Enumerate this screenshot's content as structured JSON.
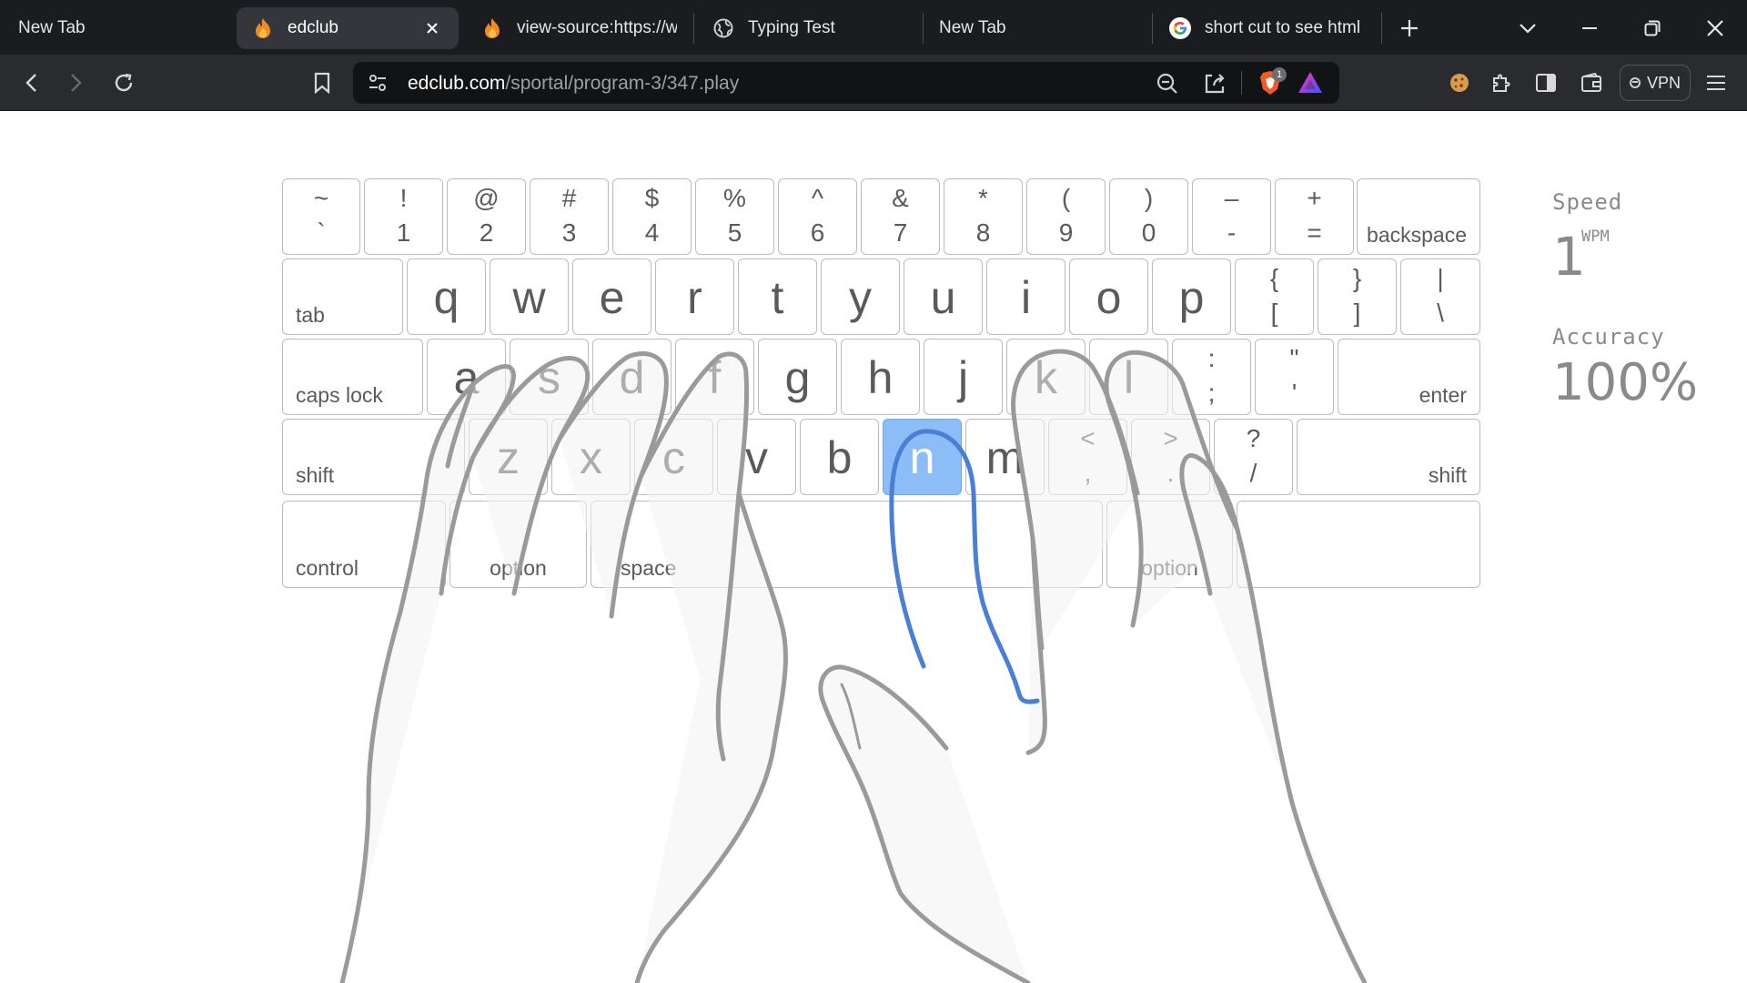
{
  "browser": {
    "tabs": [
      {
        "title": "New Tab",
        "favicon": "none",
        "active": false
      },
      {
        "title": "edclub",
        "favicon": "edclub-flame-icon",
        "active": true
      },
      {
        "title": "view-source:https://ww",
        "favicon": "edclub-flame-icon",
        "active": false
      },
      {
        "title": "Typing Test",
        "favicon": "globe-icon",
        "active": false
      },
      {
        "title": "New Tab",
        "favicon": "none",
        "active": false
      },
      {
        "title": "short cut to see html co",
        "favicon": "google-icon",
        "active": false
      }
    ],
    "url_host": "edclub.com",
    "url_path": "/sportal/program-3/347.play",
    "shields_badge": "1",
    "vpn_label": "VPN"
  },
  "keyboard": {
    "highlight_key": "n",
    "row_numbers": [
      {
        "top": "~",
        "bottom": "`"
      },
      {
        "top": "!",
        "bottom": "1"
      },
      {
        "top": "@",
        "bottom": "2"
      },
      {
        "top": "#",
        "bottom": "3"
      },
      {
        "top": "$",
        "bottom": "4"
      },
      {
        "top": "%",
        "bottom": "5"
      },
      {
        "top": "^",
        "bottom": "6"
      },
      {
        "top": "&",
        "bottom": "7"
      },
      {
        "top": "*",
        "bottom": "8"
      },
      {
        "top": "(",
        "bottom": "9"
      },
      {
        "top": ")",
        "bottom": "0"
      },
      {
        "top": "–",
        "bottom": "-"
      },
      {
        "top": "+",
        "bottom": "="
      }
    ],
    "backspace": "backspace",
    "tab": "tab",
    "row_top": [
      "q",
      "w",
      "e",
      "r",
      "t",
      "y",
      "u",
      "i",
      "o",
      "p"
    ],
    "row_top_symbols": [
      {
        "top": "{",
        "bottom": "["
      },
      {
        "top": "}",
        "bottom": "]"
      },
      {
        "top": "|",
        "bottom": "\\"
      }
    ],
    "caps_lock": "caps lock",
    "row_home": [
      "a",
      "s",
      "d",
      "f",
      "g",
      "h",
      "j",
      "k",
      "l"
    ],
    "row_home_symbols": [
      {
        "top": ":",
        "bottom": ";"
      },
      {
        "top": "\"",
        "bottom": "'"
      }
    ],
    "enter": "enter",
    "shift": "shift",
    "row_bottom": [
      "z",
      "x",
      "c",
      "v",
      "b",
      "n",
      "m"
    ],
    "row_bottom_symbols": [
      {
        "top": "<",
        "bottom": ","
      },
      {
        "top": ">",
        "bottom": "."
      },
      {
        "top": "?",
        "bottom": "/"
      }
    ],
    "control": "control",
    "option": "option",
    "space": "space"
  },
  "stats": {
    "speed_label": "Speed",
    "speed_value": "1",
    "speed_unit": "WPM",
    "accuracy_label": "Accuracy",
    "accuracy_value": "100%"
  },
  "colors": {
    "highlight": "#8dbdf7",
    "finger_active": "#4a7fd6",
    "hand_outline": "#9a9a9a"
  }
}
